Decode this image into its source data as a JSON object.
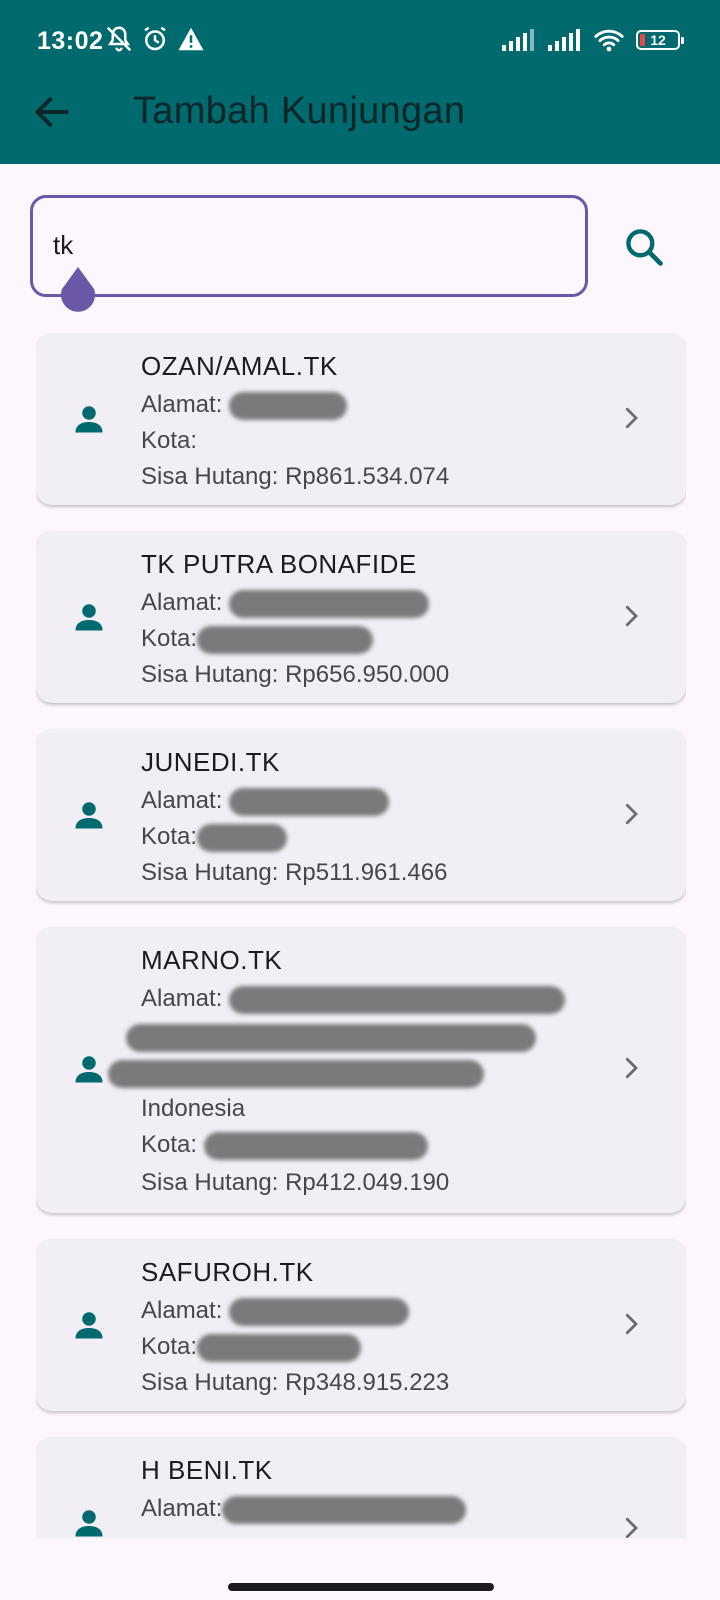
{
  "status_bar": {
    "time": "13:02",
    "battery": "12",
    "icons": [
      "mute-icon",
      "alarm-icon",
      "warning-icon",
      "signal-icon",
      "signal-icon",
      "wifi-icon",
      "battery-icon"
    ]
  },
  "app_bar": {
    "title": "Tambah Kunjungan",
    "back_icon": "arrow-left-icon"
  },
  "search": {
    "value": "tk",
    "search_icon": "search-icon"
  },
  "colors": {
    "primary": "#006a6f",
    "outline": "#6b56a8",
    "card": "#f2eef6",
    "background": "#fdf7fd"
  },
  "customers": [
    {
      "name": "OZAN/AMAL.TK",
      "alamat_label": "Alamat: ",
      "alamat": "",
      "kota_label": "Kota:",
      "kota": "",
      "hutang_label": "Sisa Hutang: ",
      "hutang": "Rp861.534.074"
    },
    {
      "name": "TK PUTRA BONAFIDE",
      "alamat_label": "Alamat: ",
      "alamat": "",
      "kota_label": "Kota:",
      "kota": "",
      "hutang_label": "Sisa Hutang: ",
      "hutang": "Rp656.950.000"
    },
    {
      "name": "JUNEDI.TK",
      "alamat_label": "Alamat: ",
      "alamat": "",
      "kota_label": "Kota:",
      "kota": "",
      "hutang_label": "Sisa Hutang: ",
      "hutang": "Rp511.961.466"
    },
    {
      "name": "MARNO.TK",
      "alamat_label": "Alamat: ",
      "alamat": "Indonesia",
      "kota_label": "Kota: ",
      "kota": "",
      "hutang_label": "Sisa Hutang: ",
      "hutang": "Rp412.049.190"
    },
    {
      "name": "SAFUROH.TK",
      "alamat_label": "Alamat: ",
      "alamat": "",
      "kota_label": "Kota:",
      "kota": "",
      "hutang_label": "Sisa Hutang: ",
      "hutang": "Rp348.915.223"
    },
    {
      "name": "H BENI.TK",
      "alamat_label": "Alamat:",
      "alamat": "",
      "kota_label": "",
      "kota": "",
      "hutang_label": "",
      "hutang": ""
    }
  ]
}
